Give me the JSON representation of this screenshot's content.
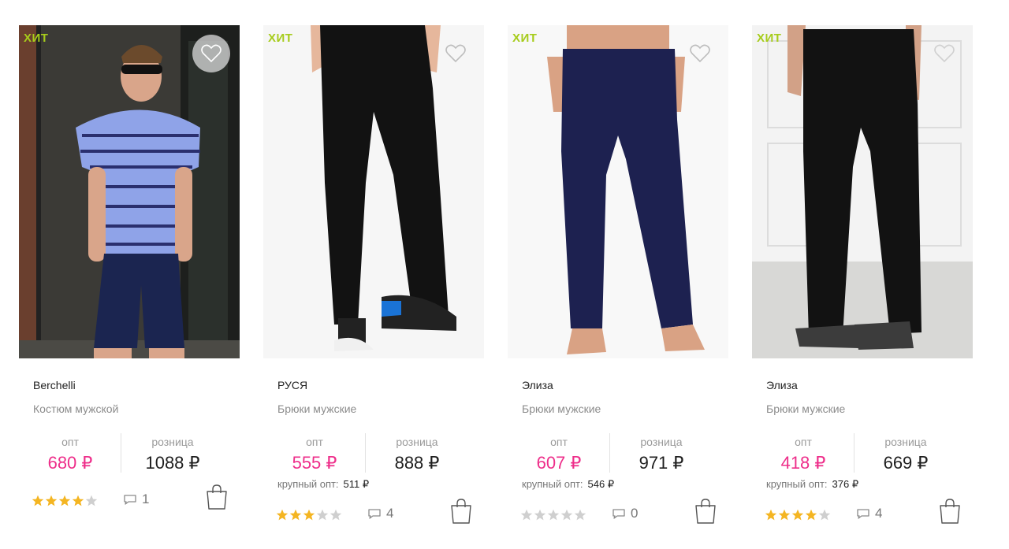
{
  "colors": {
    "opt_price": "#ee2e8a",
    "badge": "#a6cc1b",
    "star_active": "#f4b522",
    "star_inactive": "#cfcfcf"
  },
  "products": [
    {
      "badge": "ХИТ",
      "brand": "Berchelli",
      "type": "Костюм мужской",
      "opt_label": "опт",
      "retail_label": "розница",
      "opt_price": "680 ₽",
      "retail_price": "1088 ₽",
      "bulk_label": "",
      "bulk_price": "",
      "rating": 4,
      "comments": "1",
      "favorite_icon": "heart-icon",
      "cart_icon": "shopping-bag-icon"
    },
    {
      "badge": "ХИТ",
      "brand": "РУСЯ",
      "type": "Брюки мужские",
      "opt_label": "опт",
      "retail_label": "розница",
      "opt_price": "555 ₽",
      "retail_price": "888 ₽",
      "bulk_label": "крупный опт:",
      "bulk_price": "511 ₽",
      "rating": 3,
      "comments": "4",
      "favorite_icon": "heart-icon",
      "cart_icon": "shopping-bag-icon"
    },
    {
      "badge": "ХИТ",
      "brand": "Элиза",
      "type": "Брюки мужские",
      "opt_label": "опт",
      "retail_label": "розница",
      "opt_price": "607 ₽",
      "retail_price": "971 ₽",
      "bulk_label": "крупный опт:",
      "bulk_price": "546 ₽",
      "rating": 0,
      "comments": "0",
      "favorite_icon": "heart-icon",
      "cart_icon": "shopping-bag-icon"
    },
    {
      "badge": "ХИТ",
      "brand": "Элиза",
      "type": "Брюки мужские",
      "opt_label": "опт",
      "retail_label": "розница",
      "opt_price": "418 ₽",
      "retail_price": "669 ₽",
      "bulk_label": "крупный опт:",
      "bulk_price": "376 ₽",
      "rating": 4,
      "comments": "4",
      "favorite_icon": "heart-icon",
      "cart_icon": "shopping-bag-icon"
    }
  ]
}
